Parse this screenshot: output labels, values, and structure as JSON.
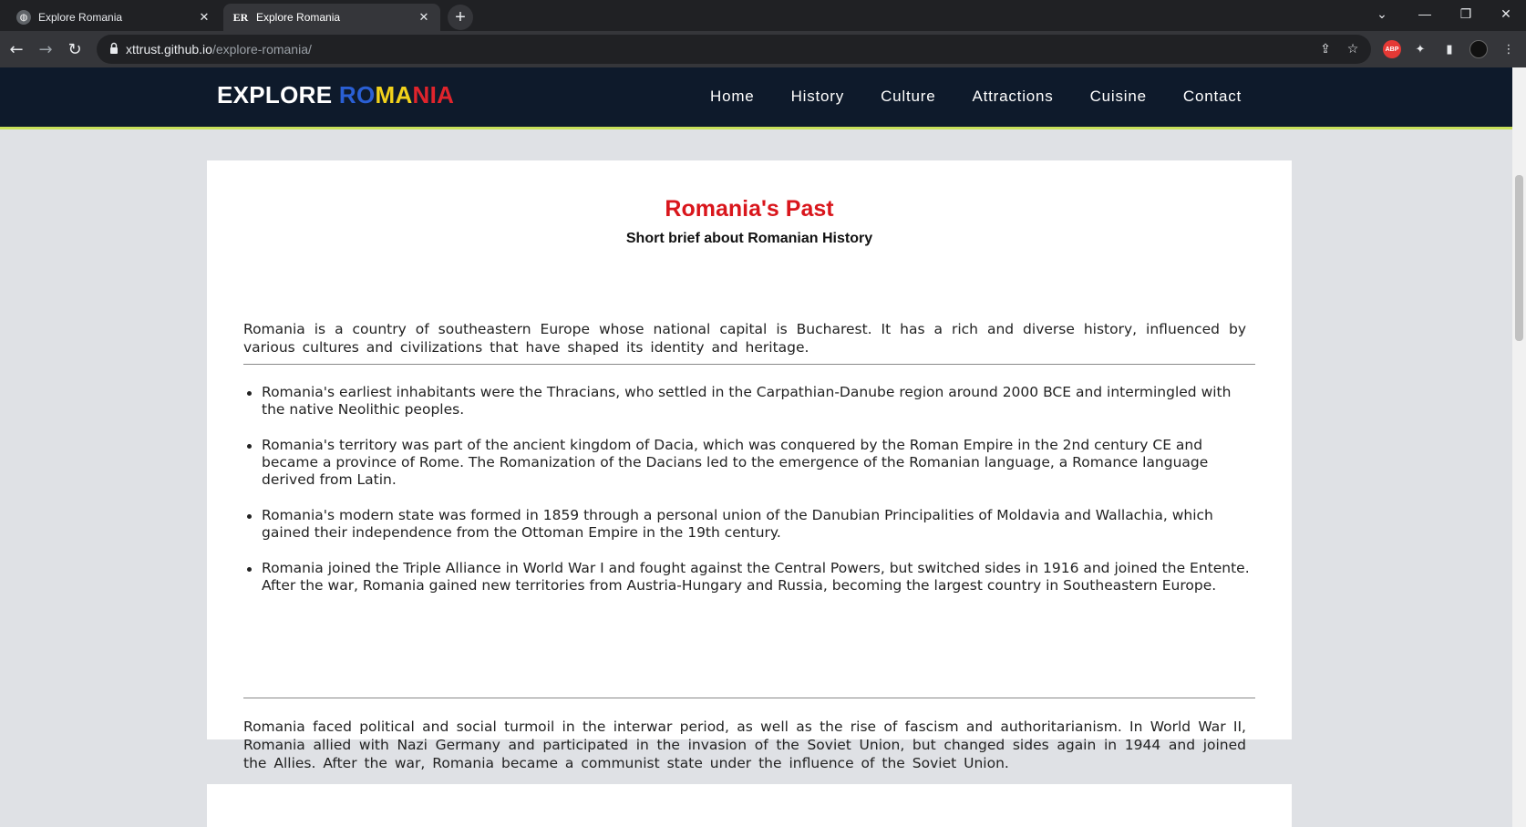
{
  "browser": {
    "tabs": [
      {
        "title": "Explore Romania",
        "favicon": "globe-icon",
        "active": false
      },
      {
        "title": "Explore Romania",
        "favicon": "ER",
        "active": true
      }
    ],
    "url_domain": "xttrust.github.io",
    "url_path": "/explore-romania/"
  },
  "site": {
    "logo": {
      "part1": "EXPLORE ",
      "part2": "RO",
      "part3": "MA",
      "part4": "NIA"
    },
    "nav": [
      "Home",
      "History",
      "Culture",
      "Attractions",
      "Cuisine",
      "Contact"
    ]
  },
  "article": {
    "title": "Romania's Past",
    "subtitle": "Short brief about Romanian History",
    "intro": "Romania is a country of southeastern Europe whose national capital is Bucharest. It has a rich and diverse history, influenced by various cultures and civilizations that have shaped its identity and heritage.",
    "bullets": [
      "Romania's earliest inhabitants were the Thracians, who settled in the Carpathian-Danube region around 2000 BCE and intermingled with the native Neolithic peoples.",
      "Romania's territory was part of the ancient kingdom of Dacia, which was conquered by the Roman Empire in the 2nd century CE and became a province of Rome. The Romanization of the Dacians led to the emergence of the Romanian language, a Romance language derived from Latin.",
      "Romania's modern state was formed in 1859 through a personal union of the Danubian Principalities of Moldavia and Wallachia, which gained their independence from the Ottoman Empire in the 19th century.",
      "Romania joined the Triple Alliance in World War I and fought against the Central Powers, but switched sides in 1916 and joined the Entente. After the war, Romania gained new territories from Austria-Hungary and Russia, becoming the largest country in Southeastern Europe."
    ],
    "outro": "Romania faced political and social turmoil in the interwar period, as well as the rise of fascism and authoritarianism. In World War II, Romania allied with Nazi Germany and participated in the invasion of the Soviet Union, but changed sides again in 1944 and joined the Allies. After the war, Romania became a communist state under the influence of the Soviet Union."
  },
  "colors": {
    "header_bg": "#0e1a2b",
    "header_border": "#c8e05a",
    "title_red": "#d9161c",
    "flag_blue": "#2a5fd4",
    "flag_yellow": "#f2d21b",
    "flag_red": "#e0242c"
  }
}
